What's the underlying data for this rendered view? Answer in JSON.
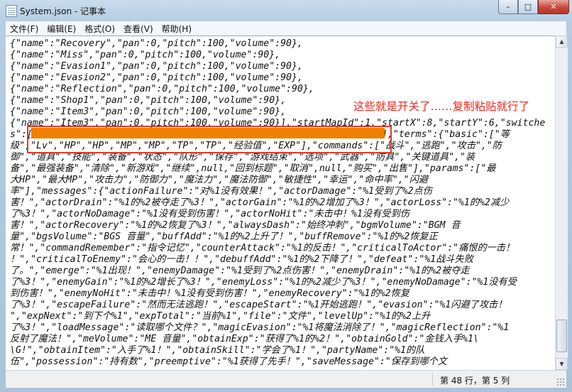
{
  "window": {
    "title": "System.json - 记事本",
    "buttons": {
      "minimize": "–",
      "maximize": "□",
      "close": "✕"
    }
  },
  "menu": [
    "文件(F)",
    "编辑(E)",
    "格式(O)",
    "查看(V)",
    "帮助(H)"
  ],
  "editor": {
    "lines": [
      "{\"name\":\"Recovery\",\"pan\":0,\"pitch\":100,\"volume\":90},",
      "{\"name\":\"Miss\",\"pan\":0,\"pitch\":100,\"volume\":90},",
      "{\"name\":\"Evasion1\",\"pan\":0,\"pitch\":100,\"volume\":90},",
      "{\"name\":\"Evasion2\",\"pan\":0,\"pitch\":100,\"volume\":90},",
      "{\"name\":\"Reflection\",\"pan\":0,\"pitch\":100,\"volume\":90},",
      "{\"name\":\"Shop1\",\"pan\":0,\"pitch\":100,\"volume\":90},",
      "{\"name\":\"Item3\",\"pan\":0,\"pitch\":100,\"volume\":90},",
      "{\"name\":\"Item3\",\"pan\":0,\"pitch\":100,\"volume\":90}],\"startMapId\":1,\"startX\":8,\"startY\":6,\"switche",
      "s\":[\"\",\"\",\"\",\"\",\"\",\"\",\"\",\"\",\"\",\"\",\"\",\"\",\"\",\"\",\"\",\"\",\"\",\"\",\"\",\"\",\"\"],\"terms\":{\"basic\":[\"等",
      "级\",\"Lv\",\"HP\",\"HP\",\"MP\",\"MP\",\"TP\",\"TP\",\"经验值\",\"EXP\"],\"commands\":[\"战斗\",\"逃跑\",\"攻击\",\"防",
      "御\",\"道具\",\"技能\",\"装备\",\"状态\",\"队形\",\"保存\",\"游戏结束\",\"选项\",\"武器\",\"防具\",\"关键道具\",\"装",
      "备\",\"最强装备\",\"清除\",\"新游戏\",\"继续\",null,\"回到标题\",\"取消\",null,\"购买\",\"出售\"],\"params\":[\"最",
      "大HP\",\"最大MP\",\"攻击力\",\"防御力\",\"魔法力\",\"魔法防御\",\"敏捷性\",\"幸运\",\"命中率\",\"闪避",
      "率\"],\"messages\":{\"actionFailure\":\"对%1没有效果！\",\"actorDamage\":\"%1受到了%2点伤",
      "害！\",\"actorDrain\":\"%1的%2被夺走了%3！\",\"actorGain\":\"%1的%2增加了%3！\",\"actorLoss\":\"%1的%2减少",
      "了%3！\",\"actorNoDamage\":\"%1没有受到伤害！\",\"actorNoHit\":\"未击中！%1没有受到伤",
      "害！\",\"actorRecovery\":\"%1的%2恢复了%3！\",\"alwaysDash\":\"始终冲刺\",\"bgmVolume\":\"BGM 音",
      "量\",\"bgsVolume\":\"BGS 音量\",\"buffAdd\":\"%1的%2上升了！\",\"buffRemove\":\"%1的%2恢复正",
      "常！\",\"commandRemember\":\"指令记忆\",\"counterAttack\":\"%1的反击！\",\"criticalToActor\":\"痛恨的一击！",
      "！\",\"criticalToEnemy\":\"会心的一击！！\",\"debuffAdd\":\"%1的%2下降了！\",\"defeat\":\"%1战斗失败",
      "了。\",\"emerge\":\"%1出现！\",\"enemyDamage\":\"%1受到了%2点伤害！\",\"enemyDrain\":\"%1的%2被夺走",
      "了%3！\",\"enemyGain\":\"%1的%2增长了%3！\",\"enemyLoss\":\"%1的%2减少了%3！\",\"enemyNoDamage\":\"%1没有受",
      "到伤害！\",\"enemyNoHit\":\"未击中！%1没有受到伤害！\",\"enemyRecovery\":\"%1的%2恢复",
      "了%3！\",\"escapeFailure\":\"然而无法逃跑！\",\"escapeStart\":\"%1开始逃跑！\",\"evasion\":\"%1闪避了攻击！",
      "\",\"expNext\":\"到下个%1\",\"expTotal\":\"当前%1\",\"file\":\"文件\",\"levelUp\":\"%1的%2上升",
      "了%3！\",\"loadMessage\":\"读取哪个文件？\",\"magicEvasion\":\"%1将魔法消除了！\",\"magicReflection\":\"%1",
      "反射了魔法！\",\"meVolume\":\"ME 音量\",\"obtainExp\":\"获得了%1的%2！\",\"obtainGold\":\"金钱入手%1\\",
      "\\G!\",\"obtainItem\":\"入手了%1！\",\"obtainSkill\":\"学会了%1！\",\"partyName\":\"%1的队",
      "伍\",\"possession\":\"持有数\",\"preemptive\":\"%1获得了先手！\",\"saveMessage\":\"保存到哪个文"
    ]
  },
  "annotation": "这些就是开关了……复制粘贴就行了",
  "status": {
    "position": "第 48 行，第 5 列"
  },
  "colors": {
    "highlight": "#f08000",
    "annotation_red": "#e03a2a"
  }
}
